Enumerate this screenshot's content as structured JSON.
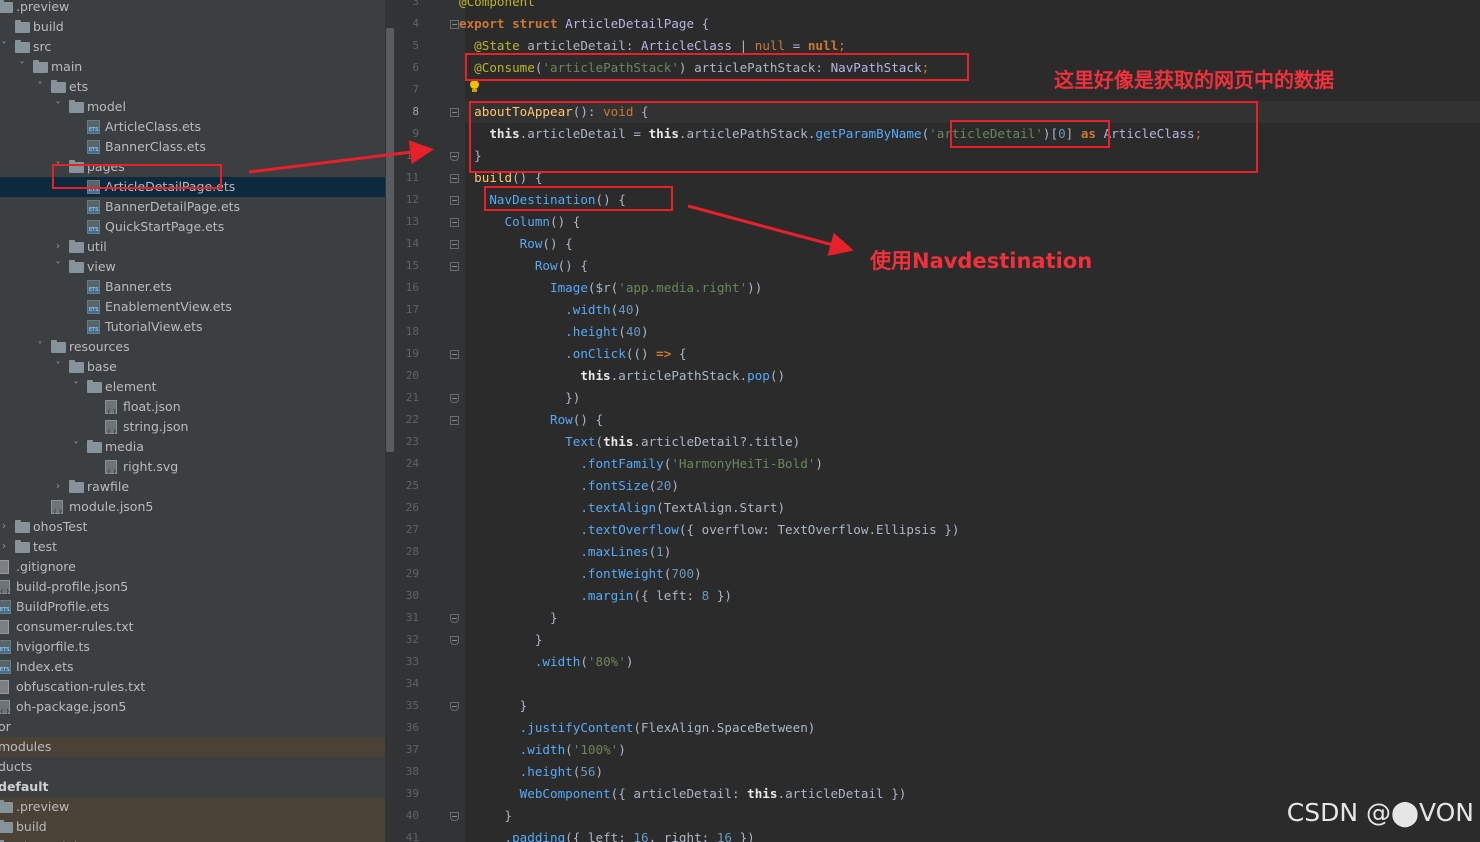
{
  "project_tree": {
    "items": [
      {
        "label": ".preview",
        "icon": "folder-icon",
        "depth": -1,
        "chevron": ""
      },
      {
        "label": "build",
        "icon": "folder-icon",
        "depth": 0,
        "chevron": ""
      },
      {
        "label": "src",
        "icon": "folder-icon",
        "depth": 0,
        "chevron": "down"
      },
      {
        "label": "main",
        "icon": "folder-icon",
        "depth": 1,
        "chevron": "down"
      },
      {
        "label": "ets",
        "icon": "folder-icon",
        "depth": 2,
        "chevron": "down"
      },
      {
        "label": "model",
        "icon": "folder-icon",
        "depth": 3,
        "chevron": "down"
      },
      {
        "label": "ArticleClass.ets",
        "icon": "ets-file-icon",
        "depth": 4,
        "chevron": ""
      },
      {
        "label": "BannerClass.ets",
        "icon": "ets-file-icon",
        "depth": 4,
        "chevron": ""
      },
      {
        "label": "pages",
        "icon": "folder-icon",
        "depth": 3,
        "chevron": "down"
      },
      {
        "label": "ArticleDetailPage.ets",
        "icon": "ets-file-icon",
        "depth": 4,
        "chevron": "",
        "selected": true
      },
      {
        "label": "BannerDetailPage.ets",
        "icon": "ets-file-icon",
        "depth": 4,
        "chevron": ""
      },
      {
        "label": "QuickStartPage.ets",
        "icon": "ets-file-icon",
        "depth": 4,
        "chevron": ""
      },
      {
        "label": "util",
        "icon": "folder-icon",
        "depth": 3,
        "chevron": "right"
      },
      {
        "label": "view",
        "icon": "folder-icon",
        "depth": 3,
        "chevron": "down"
      },
      {
        "label": "Banner.ets",
        "icon": "ets-file-icon",
        "depth": 4,
        "chevron": ""
      },
      {
        "label": "EnablementView.ets",
        "icon": "ets-file-icon",
        "depth": 4,
        "chevron": ""
      },
      {
        "label": "TutorialView.ets",
        "icon": "ets-file-icon",
        "depth": 4,
        "chevron": ""
      },
      {
        "label": "resources",
        "icon": "folder-icon",
        "depth": 2,
        "chevron": "down"
      },
      {
        "label": "base",
        "icon": "folder-icon",
        "depth": 3,
        "chevron": "down"
      },
      {
        "label": "element",
        "icon": "folder-icon",
        "depth": 4,
        "chevron": "down"
      },
      {
        "label": "float.json",
        "icon": "json-file-icon",
        "depth": 5,
        "chevron": ""
      },
      {
        "label": "string.json",
        "icon": "json-file-icon",
        "depth": 5,
        "chevron": ""
      },
      {
        "label": "media",
        "icon": "folder-icon",
        "depth": 4,
        "chevron": "down"
      },
      {
        "label": "right.svg",
        "icon": "svg-file-icon",
        "depth": 5,
        "chevron": ""
      },
      {
        "label": "rawfile",
        "icon": "folder-icon",
        "depth": 3,
        "chevron": "right"
      },
      {
        "label": "module.json5",
        "icon": "json-file-icon",
        "depth": 2,
        "chevron": ""
      },
      {
        "label": "ohosTest",
        "icon": "folder-icon",
        "depth": 0,
        "chevron": "right"
      },
      {
        "label": "test",
        "icon": "folder-icon",
        "depth": 0,
        "chevron": "right"
      },
      {
        "label": ".gitignore",
        "icon": "text-file-icon",
        "depth": -1,
        "chevron": ""
      },
      {
        "label": "build-profile.json5",
        "icon": "json-file-icon",
        "depth": -1,
        "chevron": ""
      },
      {
        "label": "BuildProfile.ets",
        "icon": "ets-file-icon",
        "depth": -1,
        "chevron": ""
      },
      {
        "label": "consumer-rules.txt",
        "icon": "text-file-icon",
        "depth": -1,
        "chevron": ""
      },
      {
        "label": "hvigorfile.ts",
        "icon": "ets-file-icon",
        "depth": -1,
        "chevron": ""
      },
      {
        "label": "Index.ets",
        "icon": "ets-file-icon",
        "depth": -1,
        "chevron": ""
      },
      {
        "label": "obfuscation-rules.txt",
        "icon": "text-file-icon",
        "depth": -1,
        "chevron": ""
      },
      {
        "label": "oh-package.json5",
        "icon": "json-file-icon",
        "depth": -1,
        "chevron": ""
      },
      {
        "label": "or",
        "icon": "",
        "depth": -2,
        "chevron": ""
      },
      {
        "label": "modules",
        "icon": "",
        "depth": -2,
        "chevron": "",
        "brown": true
      },
      {
        "label": "ducts",
        "icon": "",
        "depth": -2,
        "chevron": ""
      },
      {
        "label": "default",
        "icon": "",
        "depth": -2,
        "chevron": "",
        "bold": true
      },
      {
        "label": ".preview",
        "icon": "folder-icon",
        "depth": -1,
        "chevron": "",
        "brown": true
      },
      {
        "label": "build",
        "icon": "folder-icon",
        "depth": -1,
        "chevron": "",
        "brown": true
      },
      {
        "label": "oh_modules",
        "icon": "folder-icon",
        "depth": -1,
        "chevron": "",
        "brown": true
      }
    ]
  },
  "editor": {
    "first_line_number": 3,
    "current_line": 8,
    "lines": [
      [
        [
          "an",
          "@Component"
        ]
      ],
      [
        [
          "kwb",
          "export "
        ],
        [
          "kwb",
          "struct "
        ],
        [
          "ty",
          "ArticleDetailPage "
        ],
        [
          "cp",
          "{"
        ]
      ],
      [
        [
          "an",
          "  @State "
        ],
        [
          "cp",
          "articleDetail: "
        ],
        [
          "ty",
          "ArticleClass"
        ],
        [
          "cp",
          " | "
        ],
        [
          "kw",
          "null"
        ],
        [
          "cp",
          " = "
        ],
        [
          "kwb",
          "null"
        ],
        [
          "kw",
          ";"
        ]
      ],
      [
        [
          "an",
          "  @Consume"
        ],
        [
          "cp",
          "("
        ],
        [
          "str",
          "'articlePathStack'"
        ],
        [
          "cp",
          ") articlePathStack: "
        ],
        [
          "ty",
          "NavPathStack"
        ],
        [
          "kw",
          ";"
        ]
      ],
      [
        [
          "cp",
          ""
        ]
      ],
      [
        [
          "fn",
          "  aboutToAppear"
        ],
        [
          "cp",
          "(): "
        ],
        [
          "kw",
          "void "
        ],
        [
          "cp",
          "{"
        ]
      ],
      [
        [
          "thisw",
          "    this"
        ],
        [
          "cp",
          ".articleDetail = "
        ],
        [
          "thisw",
          "this"
        ],
        [
          "cp",
          ".articlePathStack."
        ],
        [
          "meth",
          "getParamByName"
        ],
        [
          "cp",
          "("
        ],
        [
          "str",
          "'articleDetail'"
        ],
        [
          "cp",
          ")["
        ],
        [
          "num",
          "0"
        ],
        [
          "cp",
          "] "
        ],
        [
          "kwb",
          "as "
        ],
        [
          "ty",
          "ArticleClass"
        ],
        [
          "kw",
          ";"
        ]
      ],
      [
        [
          "cp",
          "  }"
        ]
      ],
      [
        [
          "fn",
          "  build"
        ],
        [
          "cp",
          "() {"
        ]
      ],
      [
        [
          "comp",
          "    NavDestination"
        ],
        [
          "cp",
          "() {"
        ]
      ],
      [
        [
          "comp",
          "      Column"
        ],
        [
          "cp",
          "() {"
        ]
      ],
      [
        [
          "comp",
          "        Row"
        ],
        [
          "cp",
          "() {"
        ]
      ],
      [
        [
          "comp",
          "          Row"
        ],
        [
          "cp",
          "() {"
        ]
      ],
      [
        [
          "comp",
          "            Image"
        ],
        [
          "cp",
          "("
        ],
        [
          "cp",
          "$r"
        ],
        [
          "cp",
          "("
        ],
        [
          "str",
          "'app.media.right'"
        ],
        [
          "cp",
          "))"
        ]
      ],
      [
        [
          "meth",
          "              .width"
        ],
        [
          "cp",
          "("
        ],
        [
          "num",
          "40"
        ],
        [
          "cp",
          ")"
        ]
      ],
      [
        [
          "meth",
          "              .height"
        ],
        [
          "cp",
          "("
        ],
        [
          "num",
          "40"
        ],
        [
          "cp",
          ")"
        ]
      ],
      [
        [
          "meth",
          "              .onClick"
        ],
        [
          "cp",
          "(() "
        ],
        [
          "kwb",
          "=> "
        ],
        [
          "cp",
          "{"
        ]
      ],
      [
        [
          "thisw",
          "                this"
        ],
        [
          "cp",
          ".articlePathStack."
        ],
        [
          "meth",
          "pop"
        ],
        [
          "cp",
          "()"
        ]
      ],
      [
        [
          "cp",
          "              })"
        ]
      ],
      [
        [
          "comp",
          "            Row"
        ],
        [
          "cp",
          "() {"
        ]
      ],
      [
        [
          "comp",
          "              Text"
        ],
        [
          "cp",
          "("
        ],
        [
          "thisw",
          "this"
        ],
        [
          "cp",
          ".articleDetail?.title)"
        ]
      ],
      [
        [
          "meth",
          "                .fontFamily"
        ],
        [
          "cp",
          "("
        ],
        [
          "str",
          "'HarmonyHeiTi-Bold'"
        ],
        [
          "cp",
          ")"
        ]
      ],
      [
        [
          "meth",
          "                .fontSize"
        ],
        [
          "cp",
          "("
        ],
        [
          "num",
          "20"
        ],
        [
          "cp",
          ")"
        ]
      ],
      [
        [
          "meth",
          "                .textAlign"
        ],
        [
          "cp",
          "(TextAlign.Start)"
        ]
      ],
      [
        [
          "meth",
          "                .textOverflow"
        ],
        [
          "cp",
          "({ overflow: TextOverflow.Ellipsis })"
        ]
      ],
      [
        [
          "meth",
          "                .maxLines"
        ],
        [
          "cp",
          "("
        ],
        [
          "num",
          "1"
        ],
        [
          "cp",
          ")"
        ]
      ],
      [
        [
          "meth",
          "                .fontWeight"
        ],
        [
          "cp",
          "("
        ],
        [
          "num",
          "700"
        ],
        [
          "cp",
          ")"
        ]
      ],
      [
        [
          "meth",
          "                .margin"
        ],
        [
          "cp",
          "({ left: "
        ],
        [
          "num",
          "8"
        ],
        [
          "cp",
          " })"
        ]
      ],
      [
        [
          "cp",
          "            }"
        ]
      ],
      [
        [
          "cp",
          "          }"
        ]
      ],
      [
        [
          "meth",
          "          .width"
        ],
        [
          "cp",
          "("
        ],
        [
          "str",
          "'80%'"
        ],
        [
          "cp",
          ")"
        ]
      ],
      [
        [
          "cp",
          ""
        ]
      ],
      [
        [
          "cp",
          "        }"
        ]
      ],
      [
        [
          "meth",
          "        .justifyContent"
        ],
        [
          "cp",
          "(FlexAlign.SpaceBetween)"
        ]
      ],
      [
        [
          "meth",
          "        .width"
        ],
        [
          "cp",
          "("
        ],
        [
          "str",
          "'100%'"
        ],
        [
          "cp",
          ")"
        ]
      ],
      [
        [
          "meth",
          "        .height"
        ],
        [
          "cp",
          "("
        ],
        [
          "num",
          "56"
        ],
        [
          "cp",
          ")"
        ]
      ],
      [
        [
          "comp",
          "        WebComponent"
        ],
        [
          "cp",
          "({ articleDetail: "
        ],
        [
          "thisw",
          "this"
        ],
        [
          "cp",
          ".articleDetail })"
        ]
      ],
      [
        [
          "cp",
          "      }"
        ]
      ],
      [
        [
          "meth",
          "      .padding"
        ],
        [
          "cp",
          "({ left: "
        ],
        [
          "num",
          "16"
        ],
        [
          "cp",
          ", right: "
        ],
        [
          "num",
          "16"
        ],
        [
          "cp",
          " })"
        ]
      ]
    ]
  },
  "annotations": {
    "note_data": "这里好像是获取的网页中的数据",
    "note_navdestination": "使用Navdestination",
    "accent_color": "#e8202a"
  },
  "watermark": "CSDN @⬤VON"
}
